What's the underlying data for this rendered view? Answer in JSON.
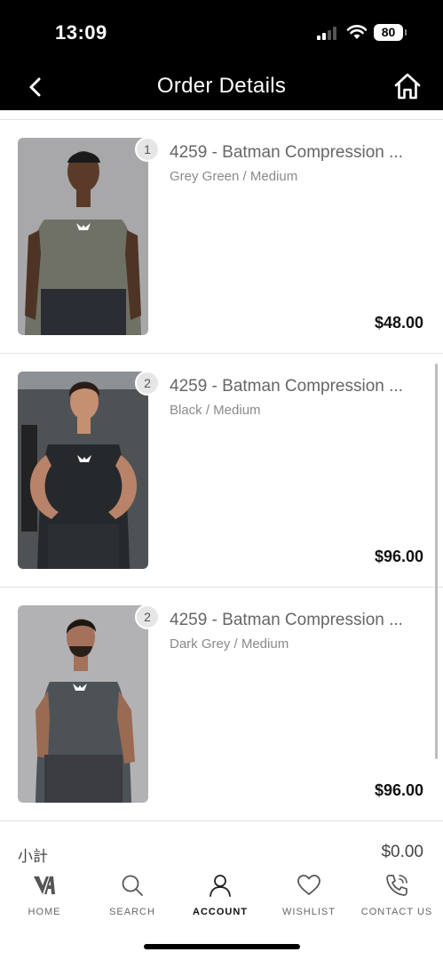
{
  "status_bar": {
    "time": "13:09",
    "battery": "80"
  },
  "header": {
    "title": "Order Details"
  },
  "items": [
    {
      "qty": "1",
      "name": "4259 - Batman Compression ...",
      "variant": "Grey Green / Medium",
      "price": "$48.00",
      "shirt_color": "#6f7066",
      "bg_color": "#a8a8aa"
    },
    {
      "qty": "2",
      "name": "4259 - Batman Compression ...",
      "variant": "Black / Medium",
      "price": "$96.00",
      "shirt_color": "#26292c",
      "bg_color": "#4f5255"
    },
    {
      "qty": "2",
      "name": "4259 - Batman Compression ...",
      "variant": "Dark Grey / Medium",
      "price": "$96.00",
      "shirt_color": "#4d5257",
      "bg_color": "#b2b2b4"
    }
  ],
  "subtotal": {
    "label": "小計",
    "value": "$0.00"
  },
  "tabs": [
    {
      "label": "HOME",
      "icon": "brand-logo-icon"
    },
    {
      "label": "SEARCH",
      "icon": "search-icon"
    },
    {
      "label": "ACCOUNT",
      "icon": "account-icon",
      "active": true
    },
    {
      "label": "WISHLIST",
      "icon": "heart-icon"
    },
    {
      "label": "CONTACT US",
      "icon": "phone-icon"
    }
  ]
}
